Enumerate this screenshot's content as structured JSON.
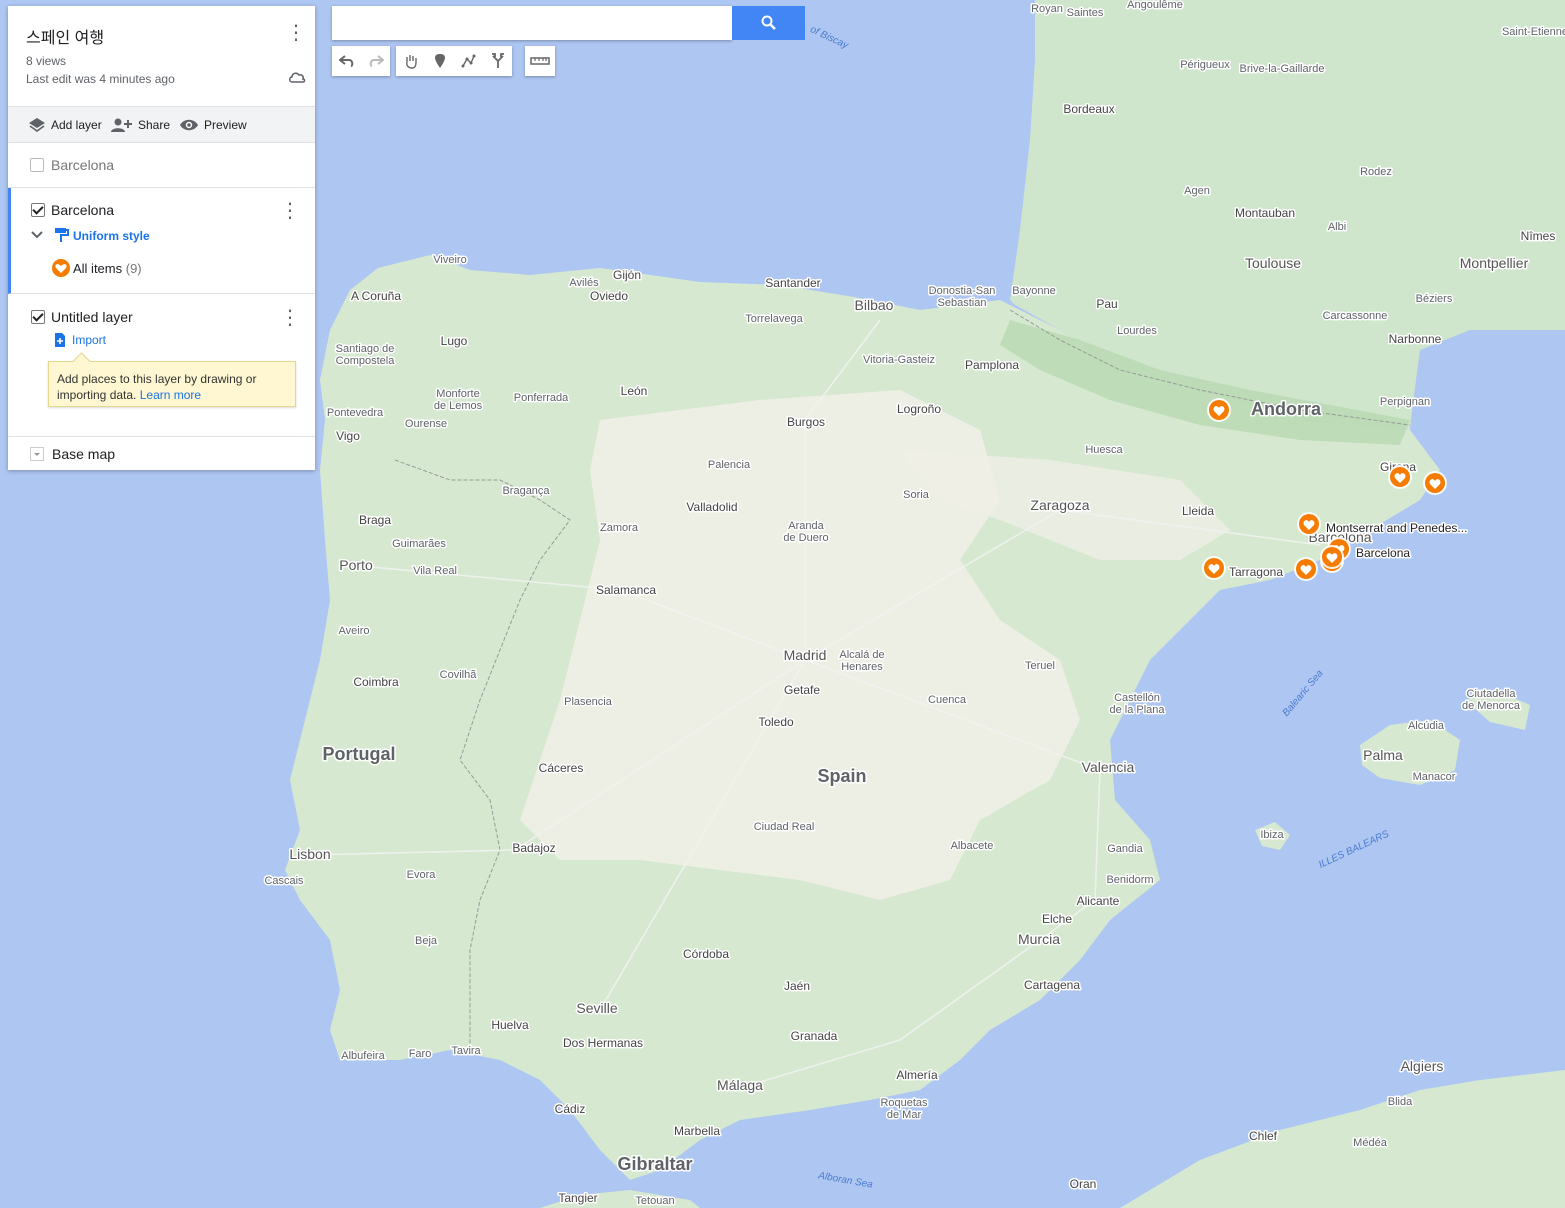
{
  "panel": {
    "title": "스페인 여행",
    "views": "8 views",
    "last_edit": "Last edit was 4 minutes ago",
    "actions": {
      "add_layer": "Add layer",
      "share": "Share",
      "preview": "Preview"
    }
  },
  "layers": [
    {
      "name": "Barcelona",
      "checked": false
    },
    {
      "name": "Barcelona",
      "checked": true,
      "style_label": "Uniform style",
      "items_label": "All items",
      "items_count": "(9)"
    },
    {
      "name": "Untitled layer",
      "checked": true,
      "import_label": "Import",
      "tip_text": "Add places to this layer by drawing or importing data.",
      "tip_link": "Learn more"
    }
  ],
  "base_map": "Base map",
  "search": {
    "value": "",
    "placeholder": ""
  },
  "toolbar": [
    "undo-icon",
    "redo-icon",
    "hand-icon",
    "add-marker-icon",
    "draw-line-icon",
    "directions-icon",
    "ruler-icon"
  ],
  "map": {
    "countries": {
      "spain": "Spain",
      "portugal": "Portugal",
      "andorra": "Andorra",
      "gibraltar": "Gibraltar"
    },
    "seas": {
      "balearic": "Balearic Sea",
      "alboran": "Alboran Sea",
      "biscay": "of Biscay",
      "illes": "ILLES BALEARS"
    },
    "cities": [
      "Madrid",
      "Barcelona",
      "Valencia",
      "Seville",
      "Zaragoza",
      "Bilbao",
      "Málaga",
      "Murcia",
      "Lisbon",
      "Porto",
      "Toulouse",
      "Montpellier",
      "Palma",
      "Bordeaux",
      "Granada",
      "Córdoba",
      "Alicante",
      "Valladolid",
      "Salamanca",
      "Burgos",
      "León",
      "Oviedo",
      "Gijón",
      "Santander",
      "A Coruña",
      "Vigo",
      "Pamplona",
      "Logroño",
      "Lleida",
      "Tarragona",
      "Girona",
      "Perpignan",
      "Narbonne",
      "Carcassonne",
      "Béziers",
      "Pau",
      "Lourdes",
      "Montauban",
      "Agen",
      "Albi",
      "Rodez",
      "Nîmes",
      "Périgueux",
      "Brive-la-Gaillarde",
      "Angoulême",
      "Royan",
      "Saintes",
      "Saint-Etienne",
      "Bayonne",
      "Donostia-San Sebastian",
      "Vitoria-Gasteiz",
      "Torrelavega",
      "Avilés",
      "Viveiro",
      "Santiago de Compostela",
      "Lugo",
      "Ourense",
      "Pontevedra",
      "Monforte de Lemos",
      "Ponferrada",
      "Palencia",
      "Soria",
      "Huesca",
      "Teruel",
      "Castellón de la Plana",
      "Cuenca",
      "Toledo",
      "Getafe",
      "Alcalá de Henares",
      "Aranda de Duero",
      "Zamora",
      "Bragança",
      "Braga",
      "Guimarães",
      "Vila Real",
      "Aveiro",
      "Coimbra",
      "Covilhã",
      "Plasencia",
      "Cáceres",
      "Badajoz",
      "Ciudad Real",
      "Albacete",
      "Gandia",
      "Benidorm",
      "Elche",
      "Cartagena",
      "Jaén",
      "Almería",
      "Roquetas de Mar",
      "Marbella",
      "Cádiz",
      "Dos Hermanas",
      "Huelva",
      "Tavira",
      "Faro",
      "Albufeira",
      "Beja",
      "Evora",
      "Cascais",
      "Ibiza",
      "Manacor",
      "Alcúdia",
      "Ciutadella de Menorca",
      "Algiers",
      "Blida",
      "Médéa",
      "Chlef",
      "Oran",
      "Tangier",
      "Tetouan"
    ],
    "markers": {
      "montserrat": "Montserrat and Penedes...",
      "barcelona": "Barcelona"
    }
  }
}
